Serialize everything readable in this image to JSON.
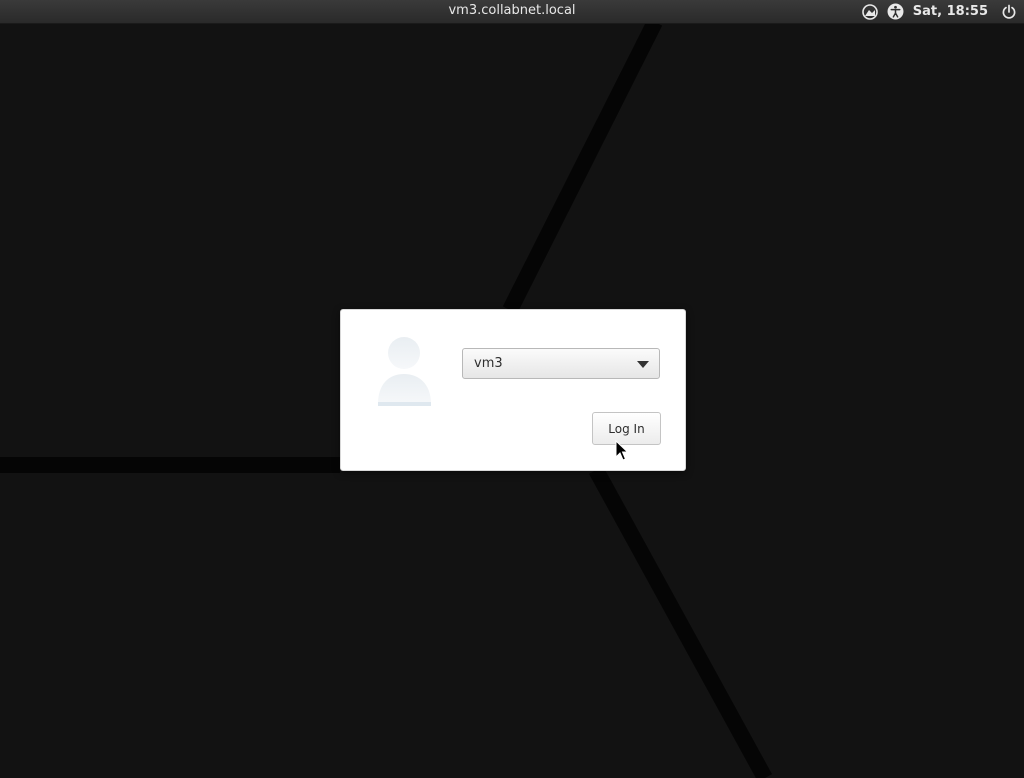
{
  "topbar": {
    "hostname": "vm3.collabnet.local",
    "clock": "Sat, 18:55",
    "icons": [
      "network-status-icon",
      "accessibility-icon",
      "power-icon"
    ]
  },
  "login": {
    "selected_user": "vm3",
    "login_button_label": "Log In",
    "avatar": "user-avatar-icon"
  },
  "colors": {
    "background": "#121212",
    "topbar": "#2f2f2f",
    "dialog": "#ffffff"
  }
}
